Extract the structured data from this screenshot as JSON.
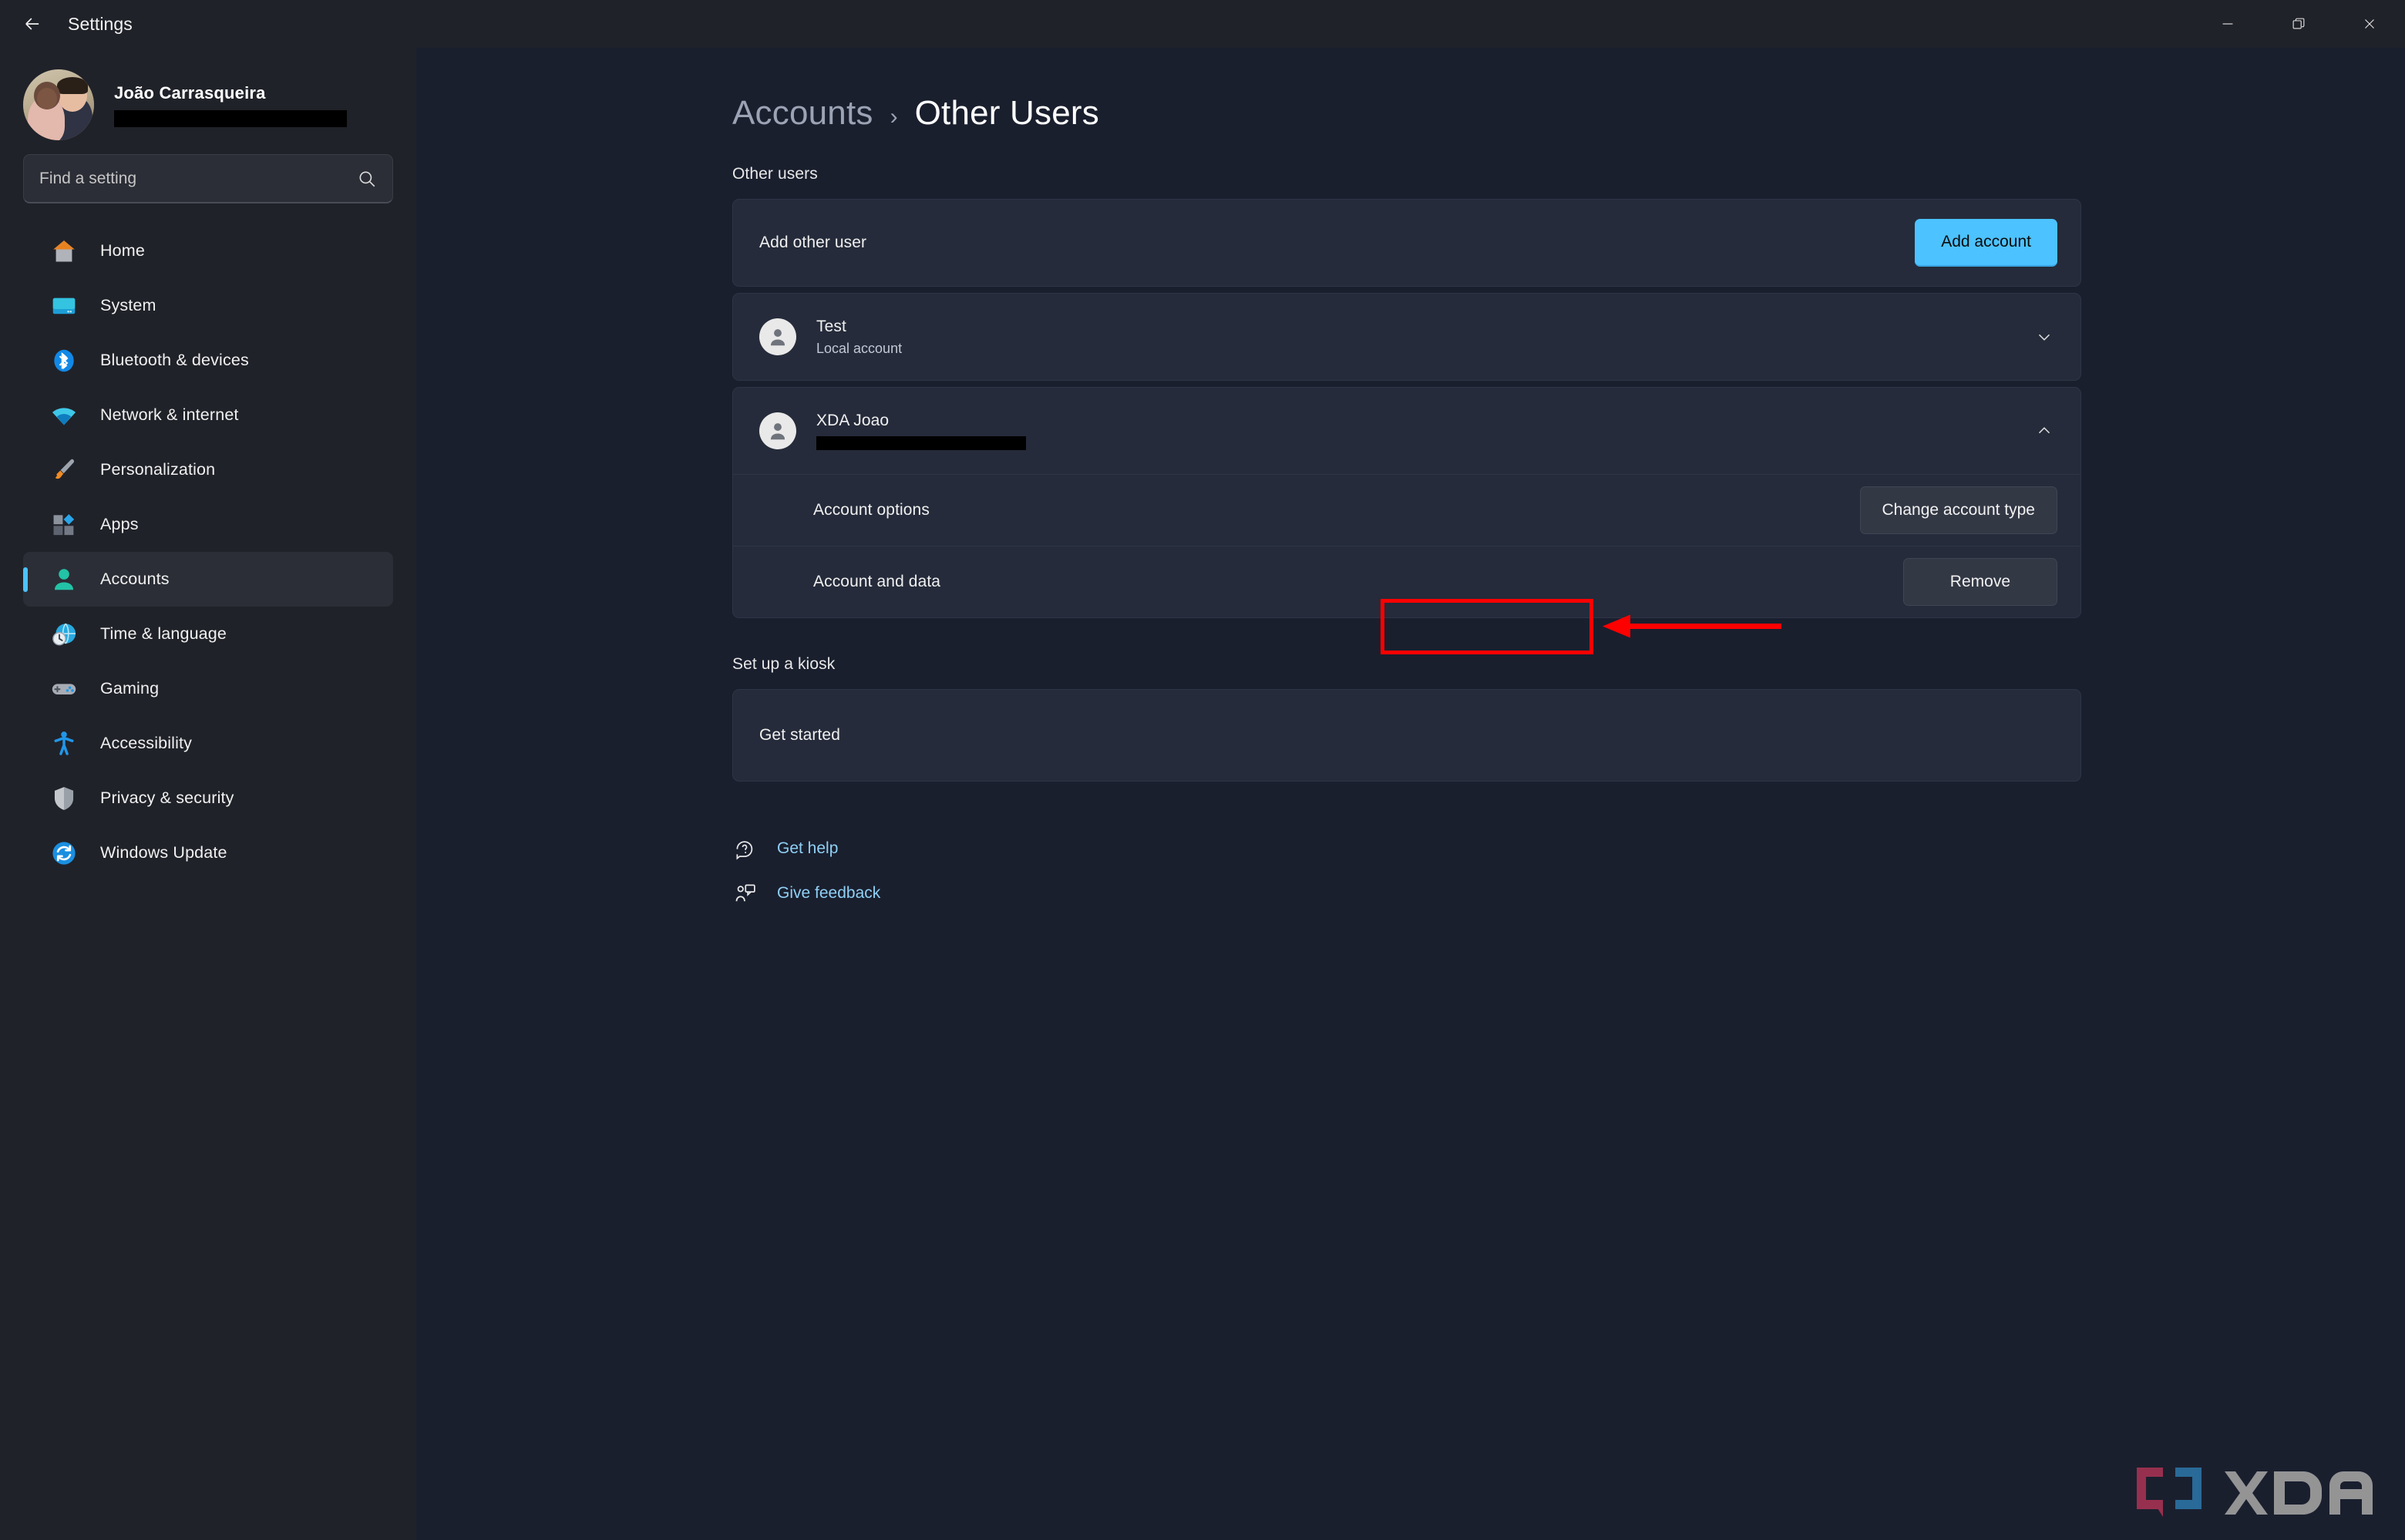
{
  "window": {
    "title": "Settings",
    "back_icon": "back-arrow-icon",
    "controls": [
      {
        "name": "minimize-button",
        "glyph": "minimize-icon"
      },
      {
        "name": "maximize-button",
        "glyph": "restore-icon"
      },
      {
        "name": "close-button",
        "glyph": "close-icon"
      }
    ]
  },
  "sidebar": {
    "profile": {
      "name": "João Carrasqueira",
      "email_redacted": true,
      "avatar_icon": "user-photo-avatar"
    },
    "search": {
      "placeholder": "Find a setting",
      "value": "",
      "icon": "search-icon"
    },
    "items": [
      {
        "label": "Home",
        "icon": "home-icon",
        "selected": false
      },
      {
        "label": "System",
        "icon": "system-icon",
        "selected": false
      },
      {
        "label": "Bluetooth & devices",
        "icon": "bluetooth-icon",
        "selected": false
      },
      {
        "label": "Network & internet",
        "icon": "network-icon",
        "selected": false
      },
      {
        "label": "Personalization",
        "icon": "personalization-icon",
        "selected": false
      },
      {
        "label": "Apps",
        "icon": "apps-icon",
        "selected": false
      },
      {
        "label": "Accounts",
        "icon": "accounts-icon",
        "selected": true
      },
      {
        "label": "Time & language",
        "icon": "time-language-icon",
        "selected": false
      },
      {
        "label": "Gaming",
        "icon": "gaming-icon",
        "selected": false
      },
      {
        "label": "Accessibility",
        "icon": "accessibility-icon",
        "selected": false
      },
      {
        "label": "Privacy & security",
        "icon": "privacy-security-icon",
        "selected": false
      },
      {
        "label": "Windows Update",
        "icon": "windows-update-icon",
        "selected": false
      }
    ]
  },
  "main": {
    "breadcrumb": {
      "parent": "Accounts",
      "separator": "›",
      "current": "Other Users"
    },
    "other_users": {
      "section_label": "Other users",
      "add_other_user": {
        "label": "Add other user",
        "button_label": "Add account",
        "button_color": "#4cc2ff"
      },
      "accounts": [
        {
          "name": "Test",
          "type": "Local account",
          "expanded": false,
          "chevron": "chevron-down-icon"
        },
        {
          "name": "XDA Joao",
          "type_redacted": true,
          "expanded": true,
          "chevron": "chevron-up-icon",
          "options": [
            {
              "label": "Account options",
              "button_label": "Change account type",
              "highlighted": false
            },
            {
              "label": "Account and data",
              "button_label": "Remove",
              "highlighted": true
            }
          ]
        }
      ]
    },
    "kiosk": {
      "section_label": "Set up a kiosk",
      "row_label": "Get started"
    },
    "links": [
      {
        "label": "Get help",
        "icon": "get-help-icon"
      },
      {
        "label": "Give feedback",
        "icon": "give-feedback-icon"
      }
    ]
  },
  "annotation": {
    "highlight_color": "#ff0000",
    "target": "Remove",
    "arrow_direction": "left"
  },
  "watermark": {
    "text": "XDA",
    "mark_colors": [
      "#9e3150",
      "#2a6f9e",
      "#9b9b9b"
    ]
  }
}
